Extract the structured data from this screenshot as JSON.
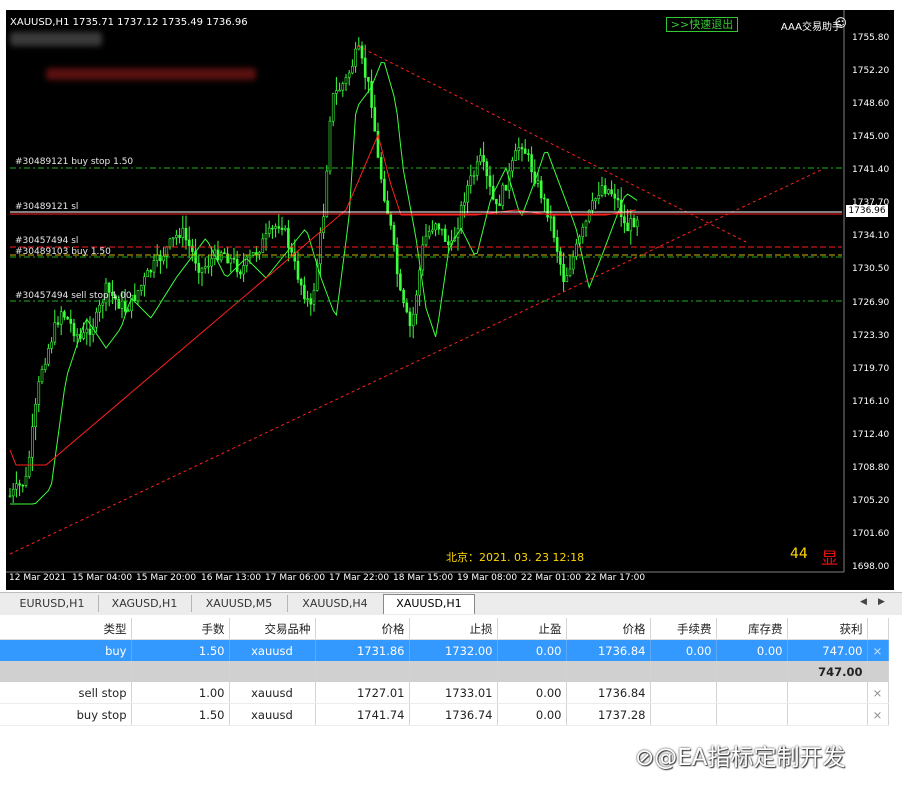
{
  "chart": {
    "header": "XAUUSD,H1  1735.71 1737.12 1735.49 1736.96",
    "exit_button": ">>快速退出",
    "helper_label": "AAA交易助手",
    "smiley": "☺",
    "current_price": "1736.96",
    "beijing_time": "北京：2021. 03. 23  12:18",
    "counter": "44",
    "display_toggle": "显",
    "order_labels": [
      "#30489121 buy stop 1.50",
      "#30489121 sl",
      "#30457494 sl",
      "#30489103 buy 1.50",
      "#30457494 sell stop 1.00"
    ],
    "price_axis": [
      "1755.80",
      "1752.20",
      "1748.60",
      "1745.00",
      "1741.40",
      "1737.70",
      "1734.10",
      "1730.50",
      "1726.90",
      "1723.30",
      "1719.70",
      "1716.10",
      "1712.40",
      "1708.80",
      "1705.20",
      "1701.60",
      "1698.00"
    ],
    "time_axis": [
      "12 Mar 2021",
      "15 Mar 04:00",
      "15 Mar 20:00",
      "16 Mar 13:00",
      "17 Mar 06:00",
      "17 Mar 22:00",
      "18 Mar 15:00",
      "19 Mar 08:00",
      "22 Mar 01:00",
      "22 Mar 17:00"
    ],
    "colors": {
      "background": "#000000",
      "candles": "#3cff3c",
      "sl_line": "#ff2020",
      "target_line": "#20b020",
      "triangle": "#ff2020"
    }
  },
  "tabs": [
    "EURUSD,H1",
    "XAGUSD,H1",
    "XAUUSD,M5",
    "XAUUSD,H4",
    "XAUUSD,H1"
  ],
  "active_tab": "XAUUSD,H1",
  "table": {
    "headers": [
      "类型",
      "手数",
      "交易品种",
      "价格",
      "止损",
      "止盈",
      "价格",
      "手续费",
      "库存费",
      "获利",
      ""
    ],
    "rows": [
      {
        "type": "buy",
        "lots": "1.50",
        "symbol": "xauusd",
        "price": "1731.86",
        "sl": "1732.00",
        "tp": "0.00",
        "current": "1736.84",
        "commission": "0.00",
        "swap": "0.00",
        "profit": "747.00",
        "close": "×"
      },
      {
        "type": "sell stop",
        "lots": "1.00",
        "symbol": "xauusd",
        "price": "1727.01",
        "sl": "1733.01",
        "tp": "0.00",
        "current": "1736.84",
        "commission": "",
        "swap": "",
        "profit": "",
        "close": "×"
      },
      {
        "type": "buy stop",
        "lots": "1.50",
        "symbol": "xauusd",
        "price": "1741.74",
        "sl": "1736.74",
        "tp": "0.00",
        "current": "1737.28",
        "commission": "",
        "swap": "",
        "profit": "",
        "close": "×"
      }
    ],
    "summary_profit": "747.00"
  },
  "watermark": "⊘@EA指标定制开发"
}
